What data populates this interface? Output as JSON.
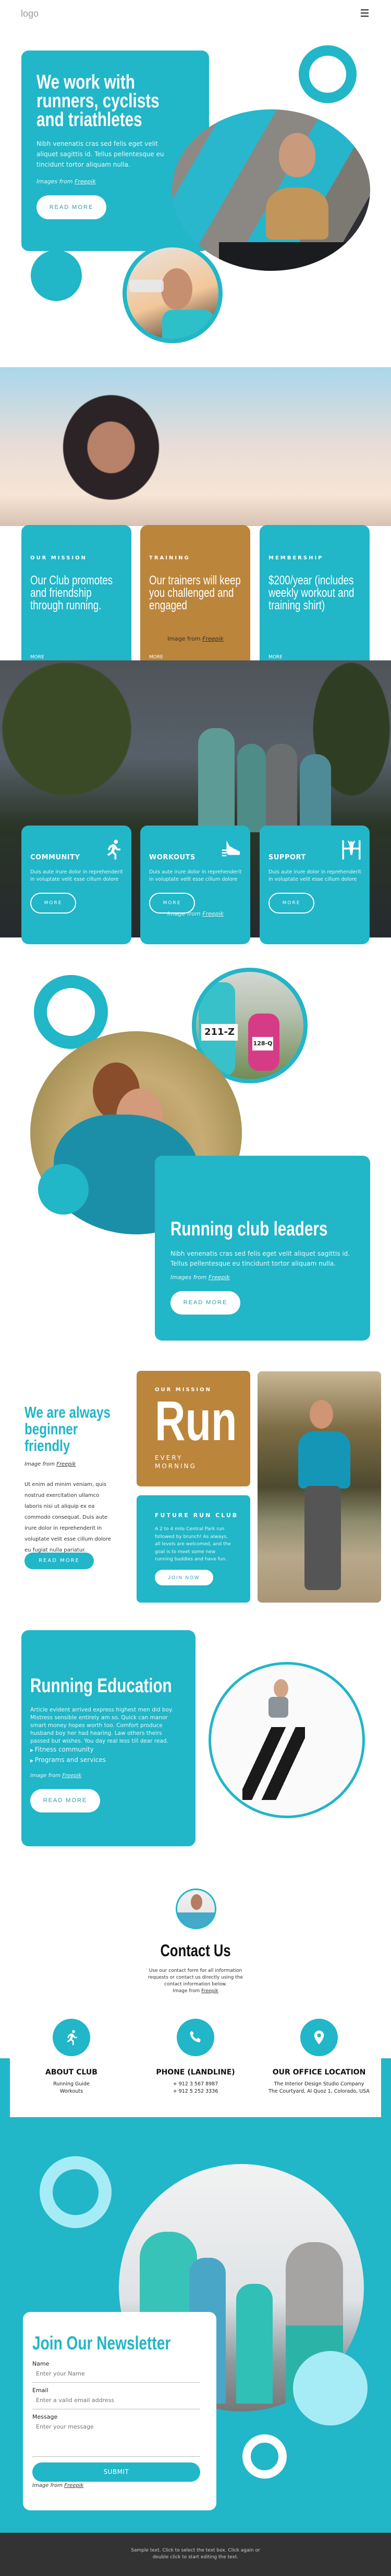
{
  "header": {
    "logo": "logo",
    "menu_icon": "hamburger-menu-icon"
  },
  "colors": {
    "primary": "#21b6c8",
    "accent": "#bb853b",
    "light": "#a6ecf6",
    "footer": "#333333"
  },
  "hero": {
    "title_lines": [
      "We work with",
      "runners, cyclists",
      "and triathletes"
    ],
    "text": "Nibh venenatis cras sed felis eget velit aliquet sagittis id. Tellus pellentesque eu tincidunt tortor aliquam nulla.",
    "credit_prefix": "Images from",
    "credit_link": "Freepik",
    "button": "READ MORE"
  },
  "features": {
    "cards": [
      {
        "label": "OUR MISSION",
        "title": "Our Club promotes and friendship through running.",
        "link": "MORE"
      },
      {
        "label": "TRAINING",
        "title": "Our trainers will keep you challenged and engaged",
        "link": "MORE"
      },
      {
        "label": "MEMBERSHIP",
        "title": "$200/year (includes weekly workout and training shirt)",
        "link": "MORE"
      }
    ],
    "credit_prefix": "Image from",
    "credit_link": "Freepik"
  },
  "services": {
    "cards": [
      {
        "title": "COMMUNITY",
        "icon": "runner-icon",
        "text": "Duis aute irure dolor in reprehenderit in voluptate velit esse cillum dolore",
        "button": "MORE"
      },
      {
        "title": "WORKOUTS",
        "icon": "sneaker-icon",
        "text": "Duis aute irure dolor in reprehenderit in voluptate velit esse cillum dolore",
        "button": "MORE"
      },
      {
        "title": "SUPPORT",
        "icon": "finish-line-icon",
        "text": "Duis aute irure dolor in reprehenderit in voluptate velit esse cillum dolore",
        "button": "MORE"
      }
    ],
    "credit_prefix": "Image from",
    "credit_link": "Freepik"
  },
  "leaders": {
    "title": "Running club leaders",
    "text": "Nibh venenatis cras sed felis eget velit aliquet sagittis id. Tellus pellentesque eu tincidunt tortor aliquam nulla.",
    "credit_prefix": "Images from",
    "credit_link": "Freepik",
    "button": "READ MORE",
    "bib_numbers": [
      "211-Z",
      "128-Q"
    ]
  },
  "beginner": {
    "title_lines": [
      "We are always",
      "beginner",
      "friendly"
    ],
    "credit_prefix": "Image from",
    "credit_link": "Freepik",
    "text": "Ut enim ad minim veniam, quis nostrud exercitation ullamco laboris nisi ut aliquip ex ea commodo consequat. Duis aute irure dolor in reprehenderit in voluptate velit esse cillum dolore eu fugiat nulla pariatur.",
    "button": "READ MORE",
    "mission_label": "OUR MISSION",
    "mission_big": "Run",
    "mission_sub": [
      "EVERY",
      "MORNING"
    ],
    "club_label": "FUTURE RUN CLUB",
    "club_text": "A 2 to 4 mile Central Park run followed by brunch! As always, all levels are welcomed, and the goal is to meet some new running buddies and have fun.",
    "club_button": "JOIN NOW"
  },
  "education": {
    "title": "Running Education",
    "text": "Article evident arrived express highest men did boy. Mistress sensible entirely am so. Quick can manor smart money hopes worth too. Comfort produce husband boy her had hearing. Law others theirs passed but wishes. You day real less till dear read.",
    "list": [
      "Fitness community",
      "Programs and services"
    ],
    "credit_prefix": "Image from",
    "credit_link": "Freepik",
    "button": "READ MORE"
  },
  "contact": {
    "title": "Contact Us",
    "text": "Use our contact form for all information requests or contact us directly using the contact information below.",
    "credit_prefix": "Image from",
    "credit_link": "Freepik",
    "columns": [
      {
        "icon": "runner-icon",
        "title": "ABOUT CLUB",
        "lines": [
          "Running Guide",
          "Workouts"
        ]
      },
      {
        "icon": "phone-icon",
        "title": "PHONE (LANDLINE)",
        "lines": [
          "+ 912 3 567 8987",
          "+ 912 5 252 3336"
        ]
      },
      {
        "icon": "location-pin-icon",
        "title": "OUR OFFICE LOCATION",
        "lines": [
          "The Interior Design Studio Company",
          "The Courtyard, Al Quoz 1, Colorado,  USA"
        ]
      }
    ]
  },
  "newsletter": {
    "title": "Join Our Newsletter",
    "name_label": "Name",
    "name_placeholder": "Enter your Name",
    "email_label": "Email",
    "email_placeholder": "Enter a valid email address",
    "message_label": "Message",
    "message_placeholder": "Enter your message",
    "submit": "SUBMIT",
    "credit_prefix": "Image from",
    "credit_link": "Freepik"
  },
  "footer": {
    "text": "Sample text. Click to select the text box. Click again or double click to start editing the text."
  }
}
